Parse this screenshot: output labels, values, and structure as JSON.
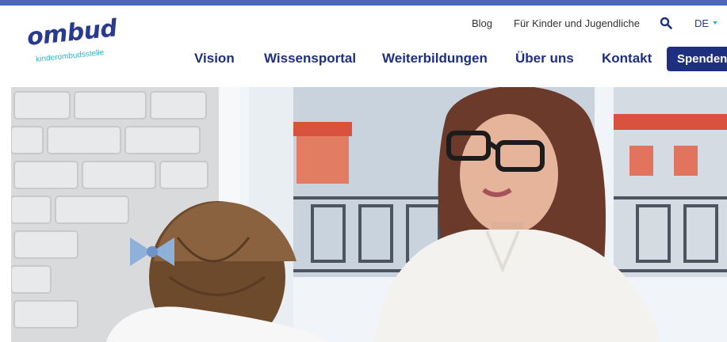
{
  "logo": {
    "wordmark": "ombud",
    "tagline": "kinderombudsstelle"
  },
  "utility_nav": {
    "blog": "Blog",
    "kids": "Für Kinder und Jugendliche",
    "language": "DE",
    "search_icon": "search-icon"
  },
  "main_nav": {
    "vision": "Vision",
    "wissensportal": "Wissensportal",
    "weiterbildungen": "Weiterbildungen",
    "ueber_uns": "Über uns",
    "kontakt": "Kontakt",
    "spenden": "Spenden"
  },
  "colors": {
    "brand_navy": "#1f2f7f",
    "top_bar": "#4a68b8",
    "accent_cyan": "#2eb4c6"
  },
  "hero": {
    "image": "photo of a woman with glasses smiling at a young girl with braided hair"
  }
}
